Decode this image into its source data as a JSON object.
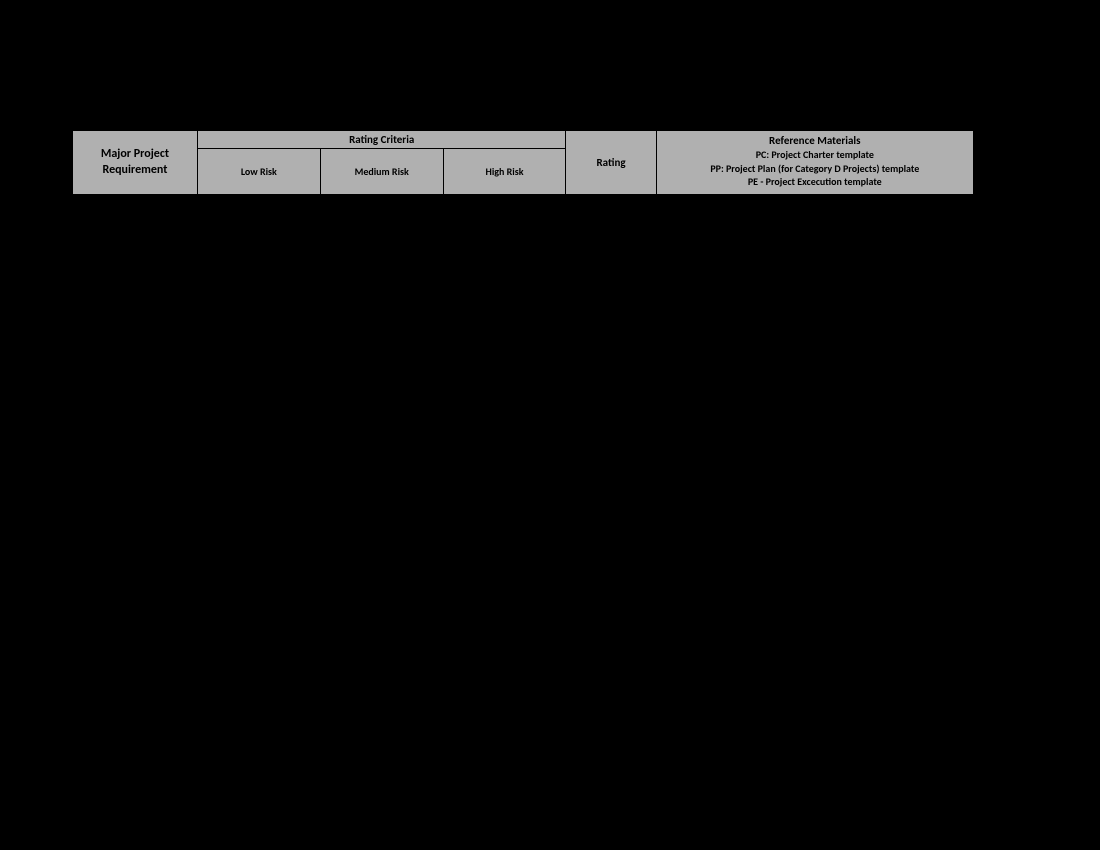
{
  "table": {
    "headers": {
      "requirement_line1": "Major Project",
      "requirement_line2": "Requirement",
      "rating_criteria": "Rating Criteria",
      "low_risk": "Low Risk",
      "medium_risk": "Medium Risk",
      "high_risk": "High Risk",
      "rating": "Rating",
      "reference_header": "Reference Materials",
      "reference_lines": {
        "line1": "PC:  Project Charter template",
        "line2": "PP:  Project Plan (for Category D Projects) template",
        "line3": "PE -  Project Excecution template"
      }
    }
  }
}
